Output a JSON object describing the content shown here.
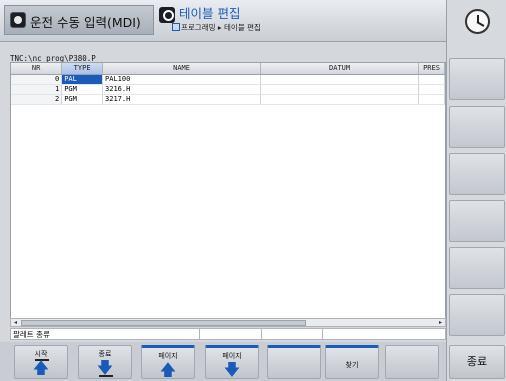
{
  "header": {
    "mode_left": "운전 수동 입력(MDI)",
    "mode_right": "테이블 편집",
    "breadcrumb": "프로그래밍 ▸ 테이블 편집"
  },
  "file_path": "TNC:\\nc_prog\\P380.P",
  "table": {
    "columns": [
      "NR",
      "TYPE",
      "NAME",
      "DATUM",
      "PRES"
    ],
    "rows": [
      {
        "nr": "0",
        "type": "PAL",
        "name": "PAL100",
        "datum": "",
        "pres": ""
      },
      {
        "nr": "1",
        "type": "PGM",
        "name": "3216.H",
        "datum": "",
        "pres": ""
      },
      {
        "nr": "2",
        "type": "PGM",
        "name": "3217.H",
        "datum": "",
        "pres": ""
      }
    ]
  },
  "status_line": "팔레트 종류",
  "softkeys": [
    {
      "label": "시작",
      "icon": "arrow-up-top-bar-icon"
    },
    {
      "label": "종료",
      "icon": "arrow-down-bottom-bar-icon"
    },
    {
      "label": "페이지",
      "icon": "arrow-up-icon"
    },
    {
      "label": "페이지",
      "icon": "arrow-down-icon"
    },
    {
      "label": "",
      "icon": ""
    },
    {
      "label": "찾기",
      "icon": ""
    },
    {
      "label": "",
      "icon": ""
    }
  ],
  "end_button": "종료",
  "colors": {
    "accent": "#1a5ab8",
    "selection": "#1a5ab8"
  }
}
